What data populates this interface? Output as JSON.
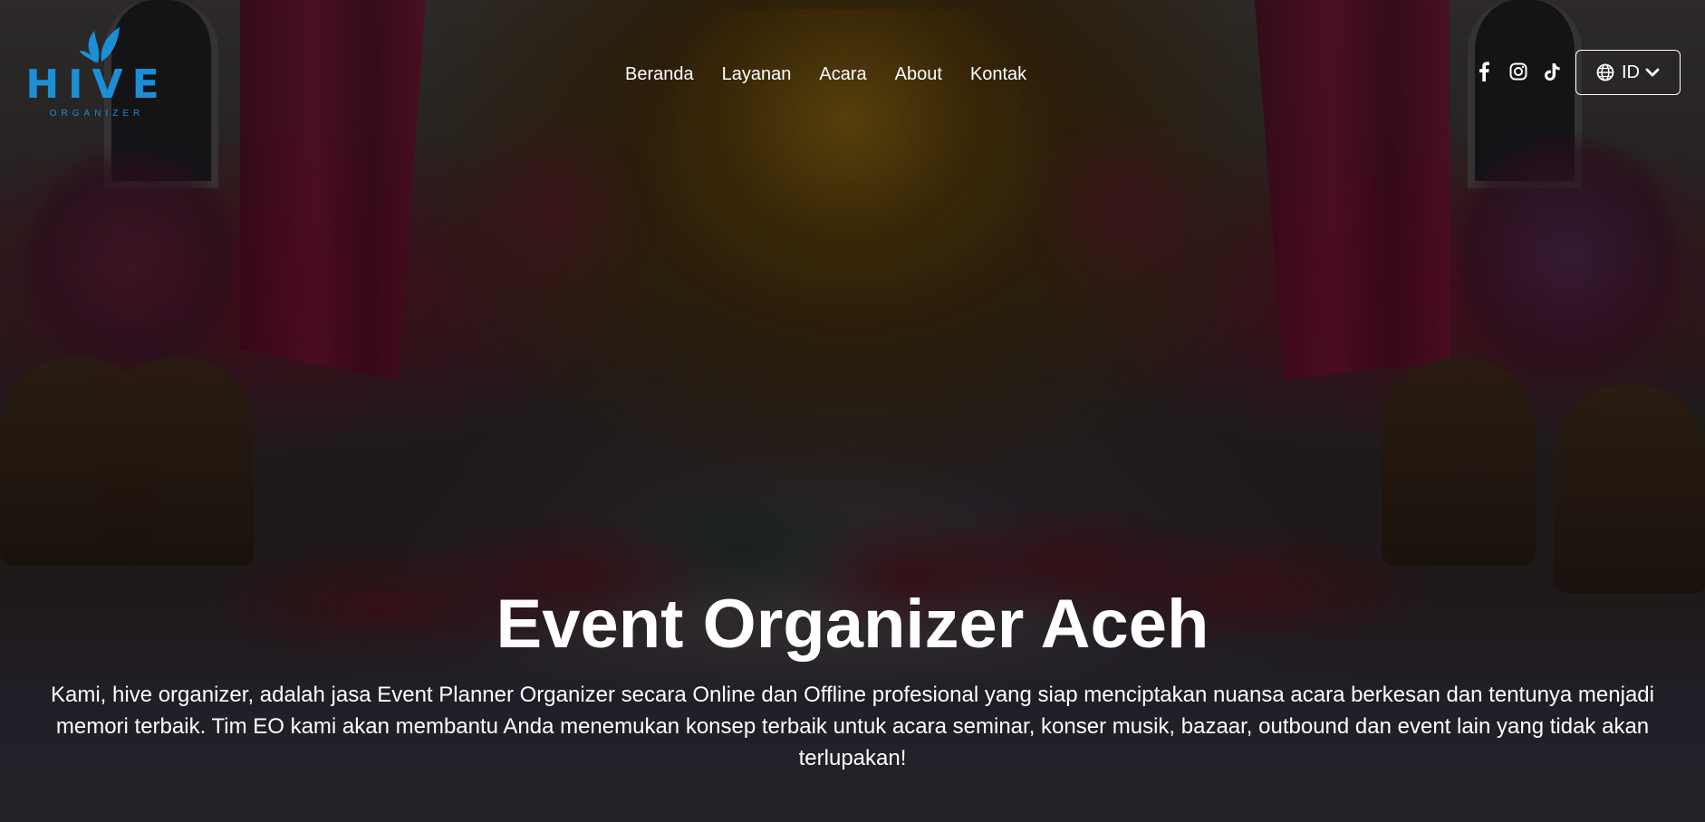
{
  "brand": {
    "name": "HIVE",
    "subtitle": "ORGANIZER",
    "logo_icon": "hive-leaf-logo-icon",
    "color": "#1a8fd6"
  },
  "nav": {
    "items": [
      {
        "label": "Beranda"
      },
      {
        "label": "Layanan"
      },
      {
        "label": "Acara"
      },
      {
        "label": "About"
      },
      {
        "label": "Kontak"
      }
    ]
  },
  "social": {
    "icons": [
      "facebook-icon",
      "instagram-icon",
      "tiktok-icon"
    ]
  },
  "language": {
    "code": "ID",
    "icon": "globe-icon",
    "dropdown_icon": "chevron-down-icon"
  },
  "hero": {
    "title": "Event Organizer Aceh",
    "description": "Kami, hive organizer, adalah jasa Event Planner Organizer secara Online dan Offline profesional yang siap menciptakan nuansa acara berkesan dan tentunya menjadi memori terbaik. Tim EO kami akan membantu Anda menemukan konsep terbaik untuk acara seminar, konser musik, bazaar, outbound dan event lain yang tidak akan terlupakan!"
  }
}
